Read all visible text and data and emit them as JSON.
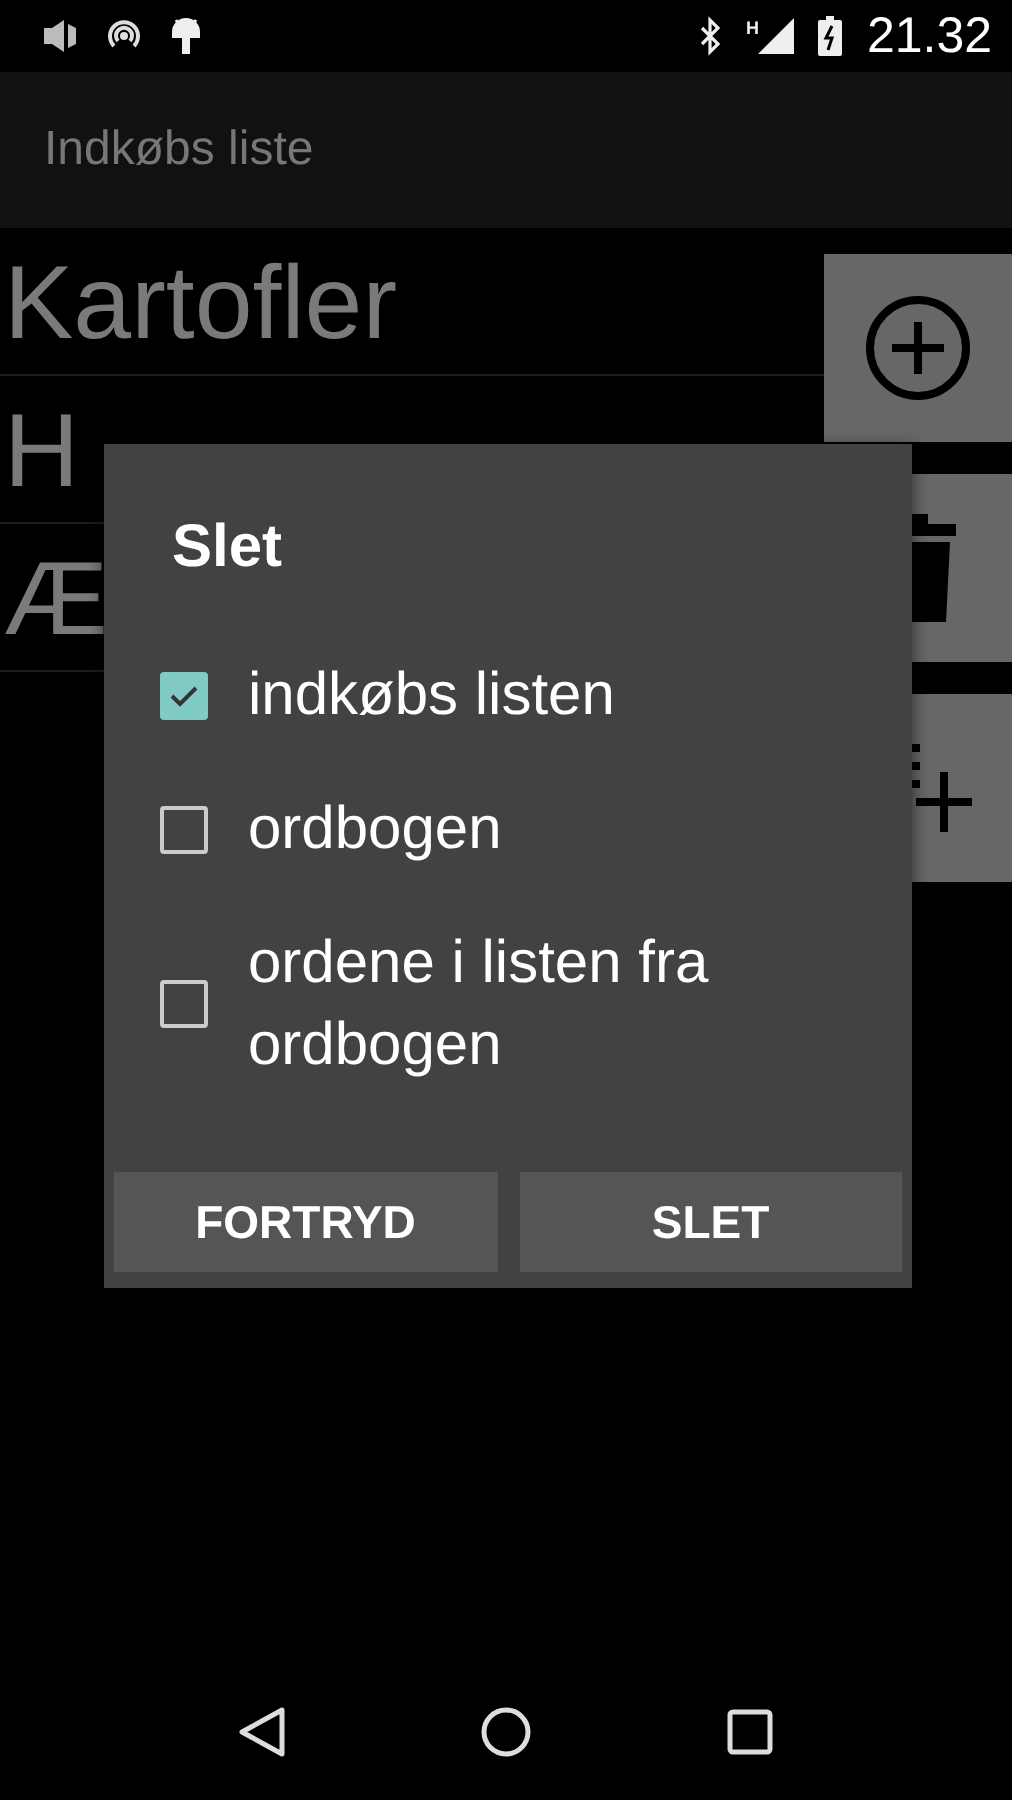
{
  "status_bar": {
    "network_label": "H",
    "time": "21.32"
  },
  "app_bar": {
    "title": "Indkøbs liste"
  },
  "list": [
    {
      "label": "Kartofler"
    },
    {
      "label": "H"
    },
    {
      "label": "Æ"
    }
  ],
  "side_buttons": [
    {
      "kind": "add"
    },
    {
      "kind": "delete"
    },
    {
      "kind": "add_list"
    }
  ],
  "dialog": {
    "title": "Slet",
    "options": [
      {
        "label": "indkøbs listen",
        "checked": true
      },
      {
        "label": "ordbogen",
        "checked": false
      },
      {
        "label": "ordene i listen fra ordbogen",
        "checked": false
      }
    ],
    "buttons": [
      "FORTRYD",
      "SLET"
    ]
  }
}
